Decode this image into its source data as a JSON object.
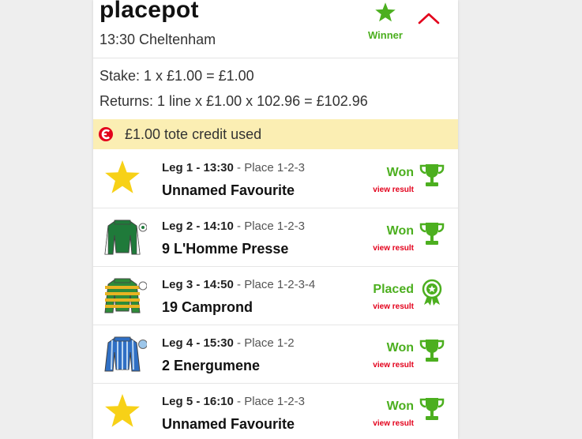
{
  "bet": {
    "title": "placepot",
    "race": "13:30 Cheltenham",
    "winner_label": "Winner",
    "stake": "Stake: 1 x £1.00 = £1.00",
    "returns": "Returns: 1 line x £1.00 x 102.96 = £102.96",
    "credit_text": "£1.00 tote credit used"
  },
  "colors": {
    "accent_red": "#e3001b",
    "won_green": "#4caf1f",
    "banner_bg": "#fbeeb3",
    "favourite_star": "#f7d117"
  },
  "legs": [
    {
      "leg": "Leg 1 - 13:30",
      "place": " - Place 1-2-3",
      "runner": "Unnamed Favourite",
      "status": "Won",
      "link": "view result",
      "silk": "favourite-star-icon",
      "result_icon": "trophy-icon"
    },
    {
      "leg": "Leg 2 - 14:10",
      "place": " - Place 1-2-3",
      "runner": "9 L'Homme Presse",
      "status": "Won",
      "link": "view result",
      "silk": "jockey-silk-icon",
      "result_icon": "trophy-icon"
    },
    {
      "leg": "Leg 3 - 14:50",
      "place": " - Place 1-2-3-4",
      "runner": "19 Camprond",
      "status": "Placed",
      "link": "view result",
      "silk": "jockey-silk-icon",
      "result_icon": "rosette-icon"
    },
    {
      "leg": "Leg 4 - 15:30",
      "place": " - Place 1-2",
      "runner": "2 Energumene",
      "status": "Won",
      "link": "view result",
      "silk": "jockey-silk-icon",
      "result_icon": "trophy-icon"
    },
    {
      "leg": "Leg 5 - 16:10",
      "place": " - Place 1-2-3",
      "runner": "Unnamed Favourite",
      "status": "Won",
      "link": "view result",
      "silk": "favourite-star-icon",
      "result_icon": "trophy-icon"
    }
  ]
}
